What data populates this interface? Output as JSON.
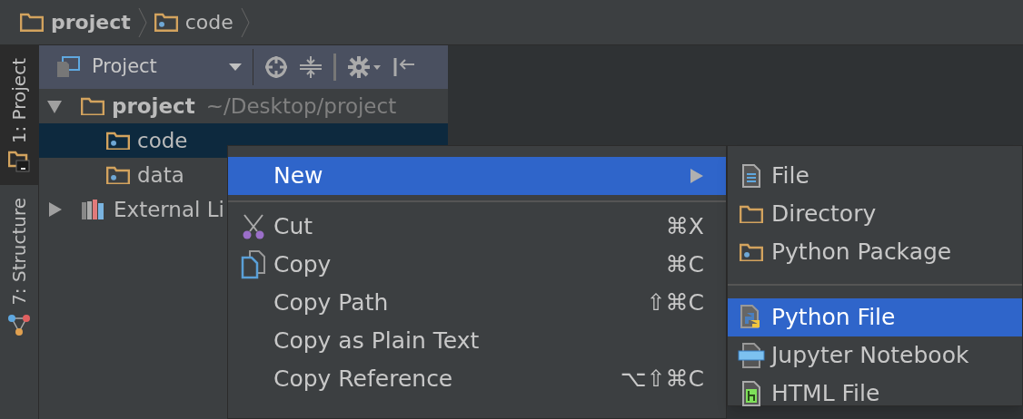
{
  "breadcrumbs": [
    {
      "label": "project",
      "kind": "folder"
    },
    {
      "label": "code",
      "kind": "package"
    }
  ],
  "tool_tabs": [
    {
      "label": "1: Project",
      "selected": true,
      "kind": "project"
    },
    {
      "label": "7: Structure",
      "selected": false,
      "kind": "structure"
    }
  ],
  "project_panel": {
    "view": "Project",
    "tree": [
      {
        "label": "project",
        "path": "~/Desktop/project",
        "kind": "folder",
        "expanded": true,
        "selected": false,
        "children": [
          {
            "label": "code",
            "kind": "package",
            "selected": true
          },
          {
            "label": "data",
            "kind": "package",
            "selected": false
          }
        ]
      },
      {
        "label": "External Li",
        "kind": "library",
        "expanded": false,
        "selected": false
      }
    ]
  },
  "context_menu": {
    "items": [
      {
        "label": "New",
        "kind": "submenu",
        "selected": true
      },
      {
        "kind": "separator"
      },
      {
        "label": "Cut",
        "shortcut": "⌘X",
        "kind": "cut",
        "selected": false
      },
      {
        "label": "Copy",
        "shortcut": "⌘C",
        "kind": "copy",
        "selected": false
      },
      {
        "label": "Copy Path",
        "shortcut": "⇧⌘C",
        "kind": "plain",
        "selected": false
      },
      {
        "label": "Copy as Plain Text",
        "kind": "plain",
        "selected": false
      },
      {
        "label": "Copy Reference",
        "shortcut": "⌥⇧⌘C",
        "kind": "plain",
        "selected": false
      }
    ]
  },
  "submenu": {
    "items": [
      {
        "label": "File",
        "kind": "file",
        "selected": false
      },
      {
        "label": "Directory",
        "kind": "folder",
        "selected": false
      },
      {
        "label": "Python Package",
        "kind": "package",
        "selected": false
      },
      {
        "kind": "separator"
      },
      {
        "label": "Python File",
        "kind": "python",
        "selected": true
      },
      {
        "label": "Jupyter Notebook",
        "kind": "jupyter",
        "selected": false
      },
      {
        "label": "HTML File",
        "kind": "html",
        "selected": false
      }
    ]
  }
}
